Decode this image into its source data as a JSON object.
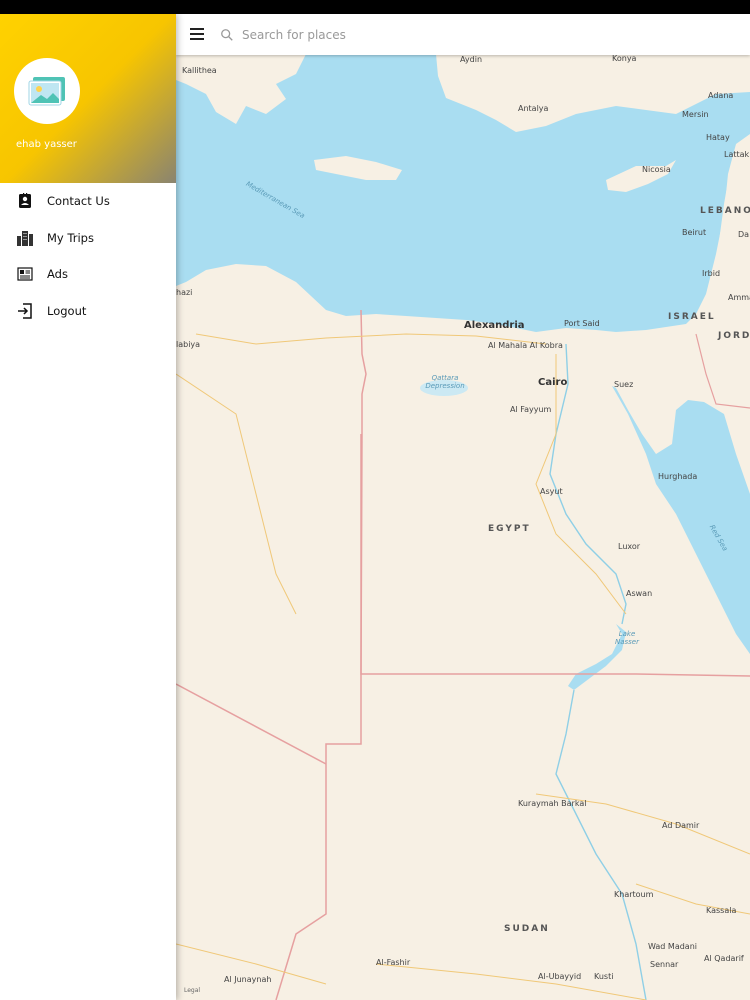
{
  "search": {
    "placeholder": "Search for places"
  },
  "drawer": {
    "user_name": "ehab yasser",
    "items": [
      {
        "label": "Contact Us",
        "icon": "contact-card-icon"
      },
      {
        "label": "My Trips",
        "icon": "city-buildings-icon"
      },
      {
        "label": "Ads",
        "icon": "newspaper-icon"
      },
      {
        "label": "Logout",
        "icon": "exit-icon"
      }
    ]
  },
  "map": {
    "legal": "Legal",
    "labels": {
      "kallithea": "Kallithea",
      "aydin": "Aydin",
      "konya": "Konya",
      "adana": "Adana",
      "antalya": "Antalya",
      "mersin": "Mersin",
      "hatay": "Hatay",
      "lattakia": "Lattak",
      "nicosia": "Nicosia",
      "lebanon": "LEBANON",
      "beirut": "Beirut",
      "damascus": "Da",
      "irbid": "Irbid",
      "amman": "Amma",
      "israel": "ISRAEL",
      "jordan": "JORDA",
      "mediterranean": "Mediterranean Sea",
      "benghazi": "hazi",
      "albayda": "labiya",
      "alexandria": "Alexandria",
      "port_said": "Port Said",
      "al_mahalla": "Al Mahala Al Kobra",
      "cairo": "Cairo",
      "suez": "Suez",
      "qattara": "Qattara Depression",
      "al_fayyum": "Al Fayyum",
      "hurghada": "Hurghada",
      "asyut": "Asyut",
      "egypt": "EGYPT",
      "red_sea": "Red Sea",
      "luxor": "Luxor",
      "aswan": "Aswan",
      "lake_nasser": "Lake Nasser",
      "kuraymah": "Kuraymah Barkal",
      "ad_damir": "Ad Damir",
      "khartoum": "Khartoum",
      "kassala": "Kassala",
      "sudan": "SUDAN",
      "wad_madani": "Wad Madani",
      "sennar": "Sennar",
      "al_qadarif": "Al Qadarif",
      "al_fashir": "Al-Fashir",
      "al_junaynah": "Al Junaynah",
      "al_ubayyid": "Al-Ubayyid",
      "kusti": "Kusti"
    }
  },
  "colors": {
    "sea": "#a9ddf1",
    "land": "#f7f0e4",
    "header_yellow": "#ffd200"
  }
}
